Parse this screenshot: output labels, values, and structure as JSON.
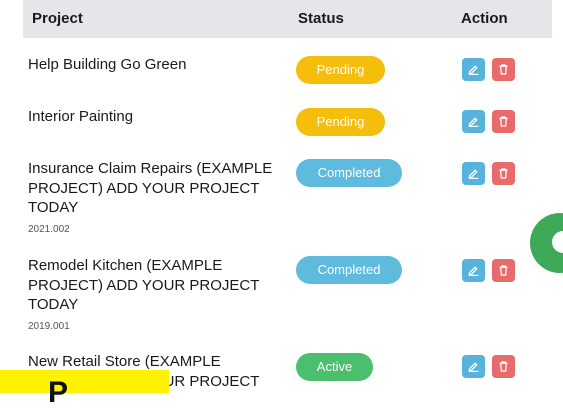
{
  "table": {
    "headers": {
      "project": "Project",
      "status": "Status",
      "action": "Action"
    },
    "rows": [
      {
        "title": "Help Building Go Green",
        "code": "",
        "status": "Pending"
      },
      {
        "title": "Interior Painting",
        "code": "",
        "status": "Pending"
      },
      {
        "title": "Insurance Claim Repairs (EXAMPLE PROJECT) ADD YOUR PROJECT TODAY",
        "code": "2021.002",
        "status": "Completed"
      },
      {
        "title": "Remodel Kitchen (EXAMPLE PROJECT) ADD YOUR PROJECT TODAY",
        "code": "2019.001",
        "status": "Completed"
      },
      {
        "title": "New Retail Store (EXAMPLE PROJECT) ADD YOUR PROJECT",
        "code": "",
        "status": "Active"
      }
    ]
  },
  "icons": {
    "edit": "edit-icon",
    "delete": "trash-icon",
    "chat": "chat-icon"
  },
  "colors": {
    "pending": "#f5bd0c",
    "completed": "#5fbbde",
    "active": "#4cbf6d",
    "edit": "#57b3de",
    "delete": "#e86a6a",
    "header_bg": "#e4e6e9"
  },
  "overlay": {
    "banner_text": "P"
  }
}
